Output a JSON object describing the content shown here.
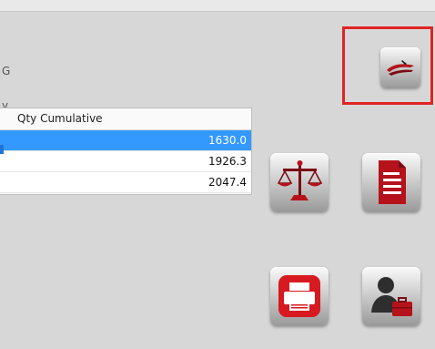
{
  "side_labels": {
    "first": "G",
    "second": "y"
  },
  "grid": {
    "column_header": "Qty Cumulative",
    "rows": [
      {
        "value": "1630.0",
        "selected": true
      },
      {
        "value": "1926.3",
        "selected": false
      },
      {
        "value": "2047.4",
        "selected": false
      }
    ]
  },
  "toolbar_icons": [
    "logo-icon",
    "scale-icon",
    "document-icon",
    "printer-icon",
    "user-briefcase-icon"
  ],
  "colors": {
    "accent_red": "#b5121b",
    "selection_blue": "#3399ff",
    "highlight_border": "#e02424"
  }
}
